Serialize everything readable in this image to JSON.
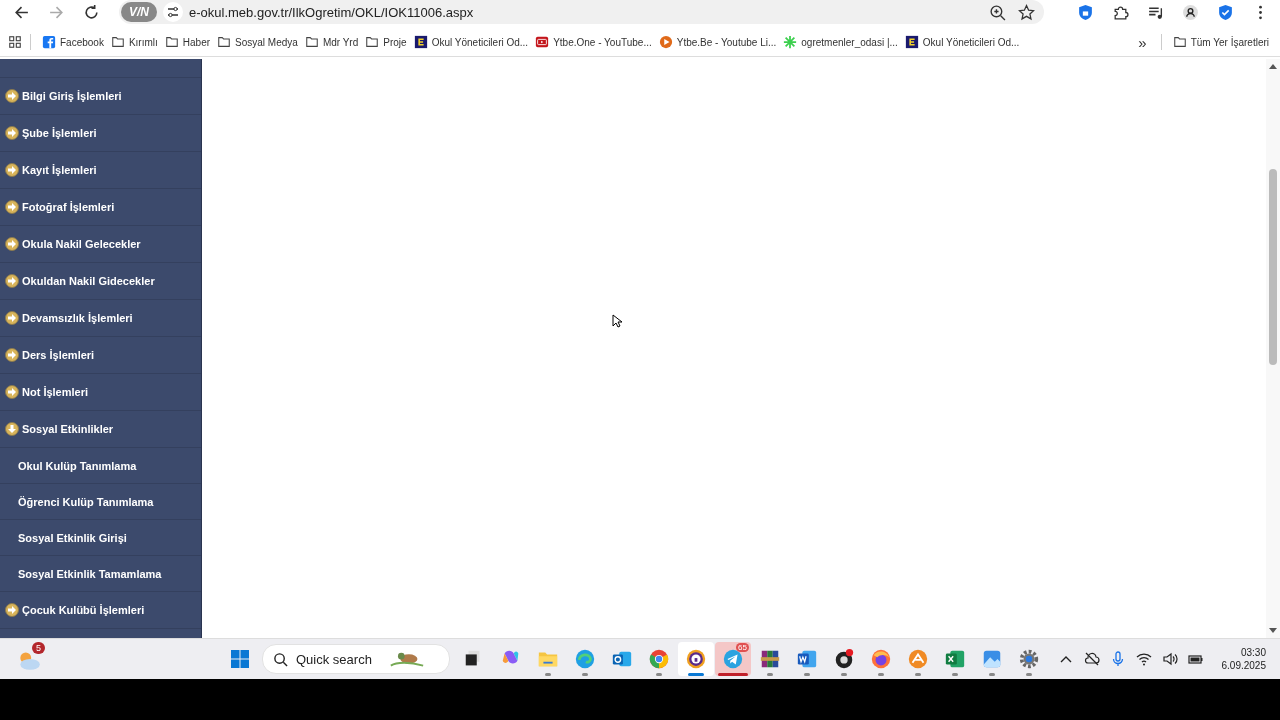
{
  "browser": {
    "url": "e-okul.meb.gov.tr/IlkOgretim/OKL/IOK11006.aspx",
    "vpn_label": "V/N"
  },
  "bookmarks": [
    {
      "kind": "facebook",
      "label": "Facebook"
    },
    {
      "kind": "folder",
      "label": "Kırımlı"
    },
    {
      "kind": "folder",
      "label": "Haber"
    },
    {
      "kind": "folder",
      "label": "Sosyal Medya"
    },
    {
      "kind": "folder",
      "label": "Mdr Yrd"
    },
    {
      "kind": "folder",
      "label": "Proje"
    },
    {
      "kind": "site",
      "label": "Okul Yöneticileri Od..."
    },
    {
      "kind": "video",
      "label": "Ytbe.One - YouTube..."
    },
    {
      "kind": "play",
      "label": "Ytbe.Be - Youtube Li..."
    },
    {
      "kind": "leaf",
      "label": "ogretmenler_odasi |..."
    },
    {
      "kind": "site",
      "label": "Okul Yöneticileri Od..."
    }
  ],
  "more_bookmarks": "»",
  "all_bookmarks": "Tüm Yer İşaretleri",
  "sidebar": {
    "items": [
      {
        "label": "Bilgi Giriş İşlemleri",
        "expanded": false
      },
      {
        "label": "Şube İşlemleri",
        "expanded": false
      },
      {
        "label": "Kayıt İşlemleri",
        "expanded": false
      },
      {
        "label": "Fotoğraf İşlemleri",
        "expanded": false
      },
      {
        "label": "Okula Nakil Gelecekler",
        "expanded": false
      },
      {
        "label": "Okuldan Nakil Gidecekler",
        "expanded": false
      },
      {
        "label": "Devamsızlık İşlemleri",
        "expanded": false
      },
      {
        "label": "Ders İşlemleri",
        "expanded": false
      },
      {
        "label": "Not İşlemleri",
        "expanded": false
      },
      {
        "label": "Sosyal Etkinlikler",
        "expanded": true,
        "children": [
          {
            "label": "Okul Kulüp Tanımlama"
          },
          {
            "label": "Öğrenci Kulüp Tanımlama"
          },
          {
            "label": "Sosyal Etkinlik Girişi"
          },
          {
            "label": "Sosyal Etkinlik Tamamlama"
          }
        ]
      },
      {
        "label": "Çocuk Kulübü İşlemleri",
        "expanded": false
      }
    ]
  },
  "taskbar": {
    "weather_badge": "5",
    "search_placeholder": "Quick search",
    "apps": [
      {
        "kind": "files",
        "running": false,
        "selected": false
      },
      {
        "kind": "copilot",
        "running": false,
        "selected": false
      },
      {
        "kind": "folder",
        "running": true,
        "selected": false
      },
      {
        "kind": "edge",
        "running": true,
        "selected": false
      },
      {
        "kind": "outlook",
        "running": false,
        "selected": false
      },
      {
        "kind": "chrome",
        "running": true,
        "selected": false
      },
      {
        "kind": "vpnbrowser",
        "running": true,
        "selected": true
      },
      {
        "kind": "telegram",
        "running": true,
        "selected": false,
        "badge": "65"
      },
      {
        "kind": "archive",
        "running": true,
        "selected": false
      },
      {
        "kind": "word",
        "running": true,
        "selected": false
      },
      {
        "kind": "obs",
        "running": true,
        "selected": false
      },
      {
        "kind": "firefox",
        "running": true,
        "selected": false
      },
      {
        "kind": "uploader",
        "running": true,
        "selected": false
      },
      {
        "kind": "excel",
        "running": true,
        "selected": false
      },
      {
        "kind": "photos",
        "running": true,
        "selected": false
      },
      {
        "kind": "settings",
        "running": true,
        "selected": false
      }
    ],
    "time": "03:30",
    "date": "6.09.2025"
  }
}
